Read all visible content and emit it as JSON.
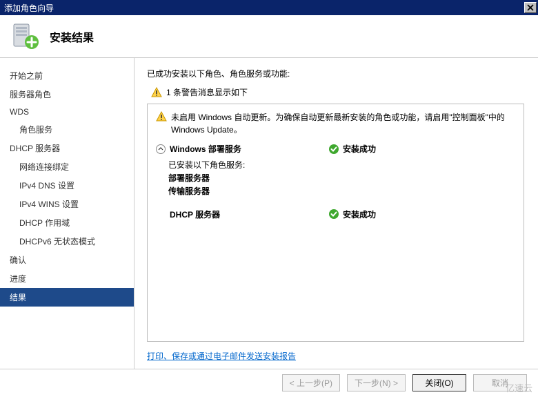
{
  "window": {
    "title": "添加角色向导"
  },
  "header": {
    "title": "安装结果"
  },
  "sidebar": {
    "items": [
      {
        "label": "开始之前",
        "indent": 0
      },
      {
        "label": "服务器角色",
        "indent": 0
      },
      {
        "label": "WDS",
        "indent": 0
      },
      {
        "label": "角色服务",
        "indent": 1
      },
      {
        "label": "DHCP 服务器",
        "indent": 0
      },
      {
        "label": "网络连接绑定",
        "indent": 1
      },
      {
        "label": "IPv4 DNS 设置",
        "indent": 1
      },
      {
        "label": "IPv4 WINS 设置",
        "indent": 1
      },
      {
        "label": "DHCP 作用域",
        "indent": 1
      },
      {
        "label": "DHCPv6 无状态模式",
        "indent": 1
      },
      {
        "label": "确认",
        "indent": 0
      },
      {
        "label": "进度",
        "indent": 0
      },
      {
        "label": "结果",
        "indent": 0,
        "active": true
      }
    ]
  },
  "content": {
    "summary": "已成功安装以下角色、角色服务或功能:",
    "warning_count_line": "1 条警告消息显示如下",
    "update_warning": "未启用 Windows 自动更新。为确保自动更新最新安装的角色或功能，请启用\"控制面板\"中的 Windows Update。",
    "roles": [
      {
        "name": "Windows 部署服务",
        "status": "安装成功",
        "sub_label": "已安装以下角色服务:",
        "sub_items": [
          "部署服务器",
          "传输服务器"
        ]
      },
      {
        "name": "DHCP 服务器",
        "status": "安装成功"
      }
    ],
    "link": "打印、保存或通过电子邮件发送安装报告"
  },
  "footer": {
    "prev": "< 上一步(P)",
    "next": "下一步(N) >",
    "close": "关闭(O)",
    "cancel": "取消"
  },
  "watermark": "亿速云"
}
